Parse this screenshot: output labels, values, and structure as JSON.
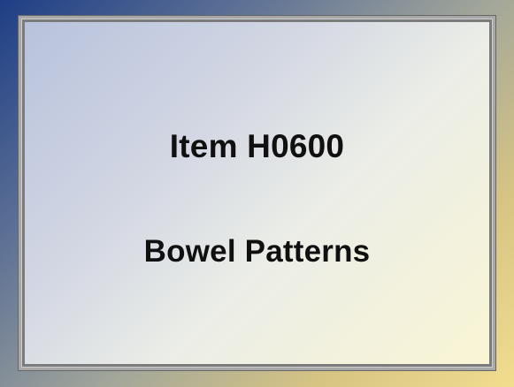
{
  "slide": {
    "title": "Item H0600",
    "subtitle": "Bowel Patterns"
  },
  "colors": {
    "frame_dark": "#1e3e85",
    "frame_light": "#f2dd8e",
    "panel_light": "#f9f5d4",
    "panel_blue": "#b7c2dc",
    "text": "#101010"
  }
}
